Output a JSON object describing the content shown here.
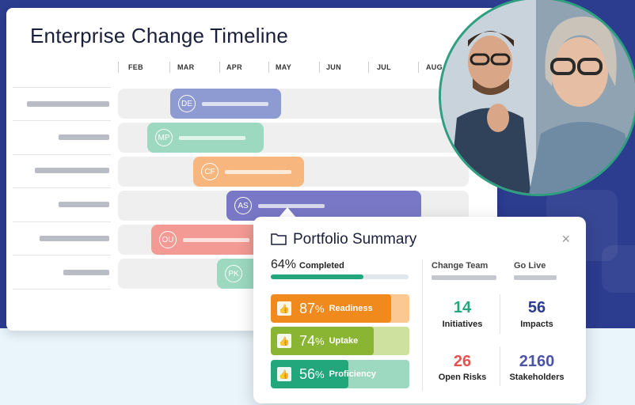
{
  "timeline": {
    "title": "Enterprise Change Timeline",
    "months": [
      "FEB",
      "MAR",
      "APR",
      "MAY",
      "JUN",
      "JUL",
      "AUG"
    ],
    "bars": [
      {
        "badge": "DE",
        "color": "#8e9ad2"
      },
      {
        "badge": "MP",
        "color": "#9cd9c0"
      },
      {
        "badge": "CF",
        "color": "#f7b67e"
      },
      {
        "badge": "AS",
        "color": "#7878c6"
      },
      {
        "badge": "OU",
        "color": "#f29a93"
      },
      {
        "badge": "PK",
        "color": "#9cd9c0"
      }
    ]
  },
  "summary": {
    "title": "Portfolio Summary",
    "close": "×",
    "completed_pct": "64",
    "completed_pct_value": 64,
    "completed_sign": "%",
    "completed_label": "Completed",
    "metrics": [
      {
        "pct": "87",
        "sign": "%",
        "label": "Readiness",
        "value": 87,
        "color": "#f08a1c",
        "track": "#fbc894"
      },
      {
        "pct": "74",
        "sign": "%",
        "label": "Uptake",
        "value": 74,
        "color": "#8ab533",
        "track": "#cfe19e"
      },
      {
        "pct": "56",
        "sign": "%",
        "label": "Proficiency",
        "value": 56,
        "color": "#22a77c",
        "track": "#9cd9c0"
      }
    ],
    "col_change_team": "Change Team",
    "col_go_live": "Go Live",
    "stats": {
      "initiatives_num": "14",
      "initiatives_lbl": "Initiatives",
      "initiatives_color": "#22a77c",
      "impacts_num": "56",
      "impacts_lbl": "Impacts",
      "impacts_color": "#2c3c8f",
      "risks_num": "26",
      "risks_lbl": "Open Risks",
      "risks_color": "#e8514f",
      "stakeholders_num": "2160",
      "stakeholders_lbl": "Stakeholders",
      "stakeholders_color": "#4a55a8"
    }
  }
}
